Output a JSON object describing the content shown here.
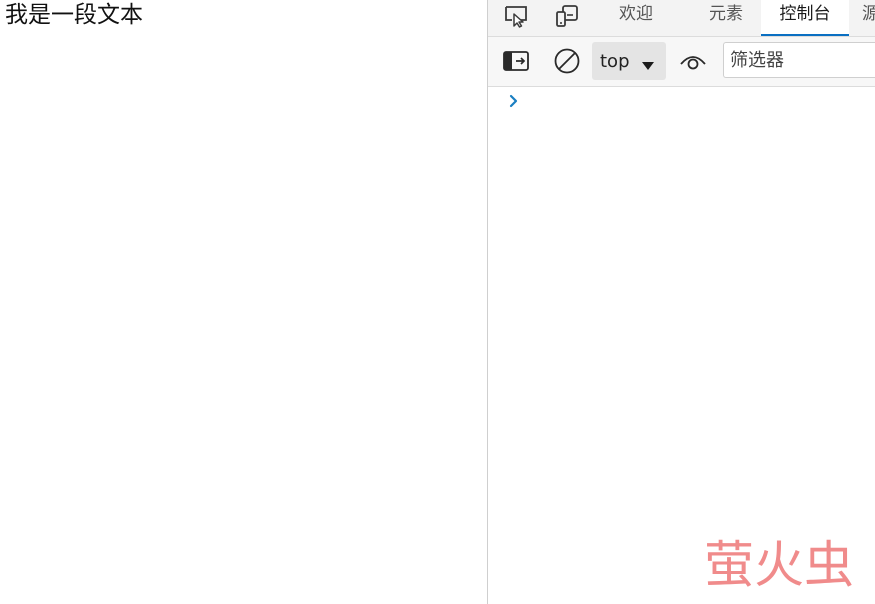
{
  "page": {
    "text": "我是一段文本"
  },
  "devtools": {
    "tabs": [
      {
        "label": "欢迎"
      },
      {
        "label": "元素"
      },
      {
        "label": "控制台"
      },
      {
        "label": "源"
      }
    ],
    "active_tab": "控制台",
    "toolbar": {
      "context_value": "top",
      "filter_placeholder": "筛选器"
    },
    "icons": {
      "inspect": "inspect-element-icon",
      "device": "device-emulation-icon",
      "sidebar": "show-sidebar-icon",
      "clear": "clear-console-icon",
      "dropdown": "dropdown-caret-icon",
      "live_expression": "live-expression-eye-icon",
      "prompt": "console-prompt-chevron-icon"
    },
    "colors": {
      "active_tab_underline": "#0a6fc2",
      "prompt": "#1a7fc1"
    }
  },
  "watermark": {
    "text": "萤火虫",
    "color": "#f08b8b"
  }
}
